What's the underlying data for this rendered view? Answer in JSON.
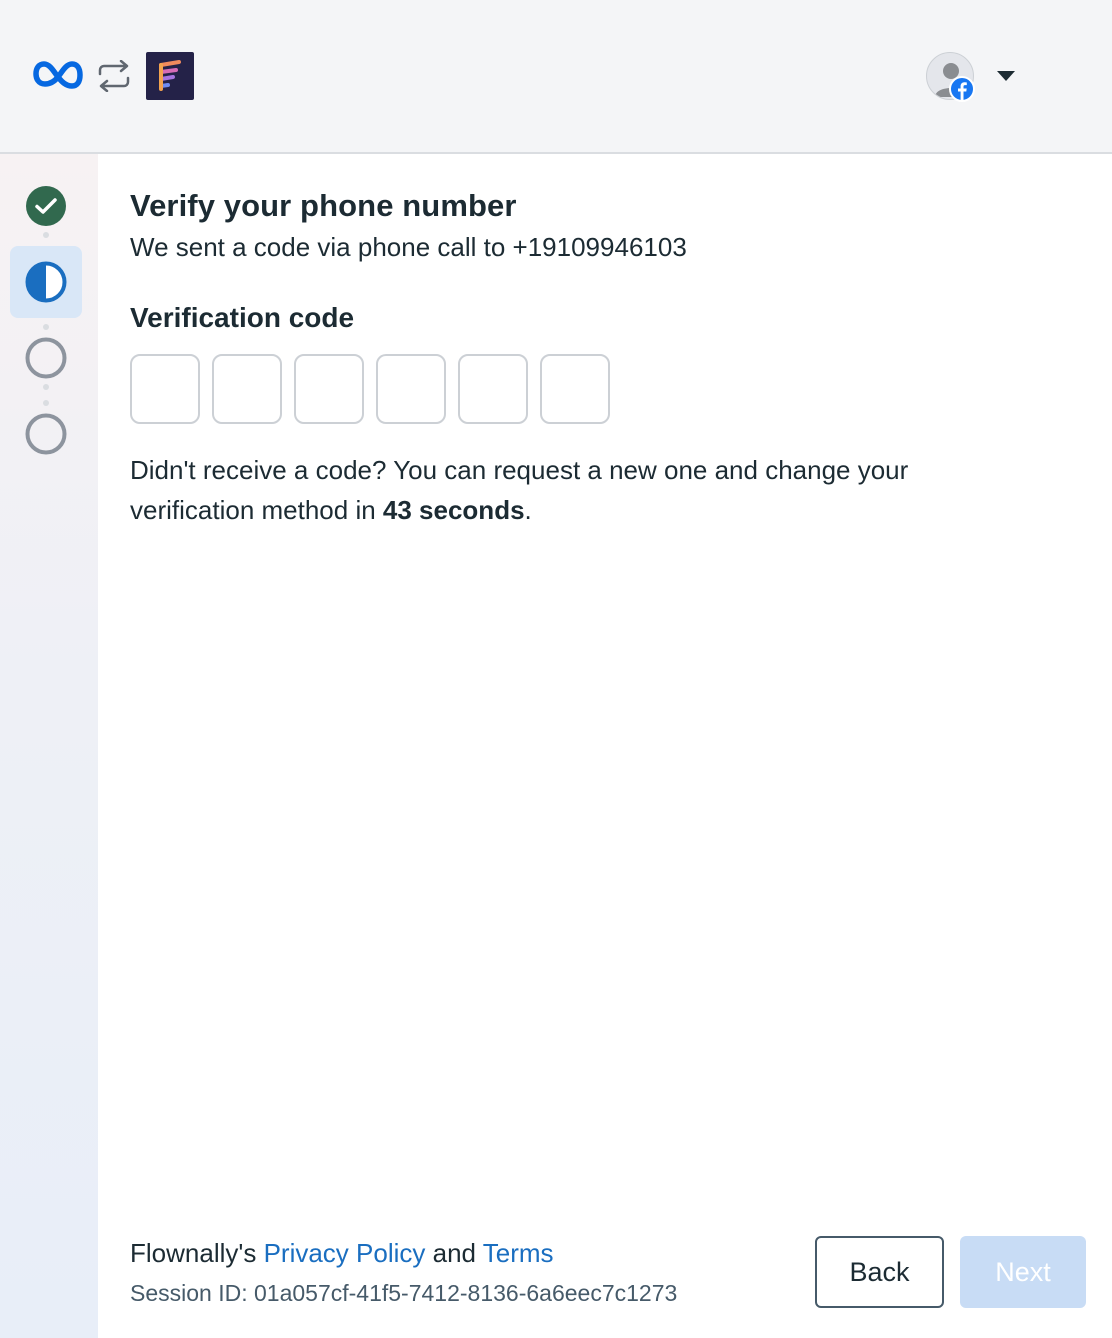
{
  "header": {
    "brand_icon": "meta-logo-icon",
    "connect_icon": "swap-arrows-icon",
    "app_icon": "flownally-logo-icon",
    "account_icon": "facebook-icon",
    "menu_icon": "chevron-down-icon",
    "colors": {
      "meta_blue": "#0668e1",
      "facebook_blue": "#1877f2",
      "app_logo_bg": "#242248"
    }
  },
  "steps": [
    {
      "state": "complete",
      "icon": "check-circle-icon",
      "color": "#31694e"
    },
    {
      "state": "current",
      "icon": "half-circle-icon",
      "color": "#1a6ec0"
    },
    {
      "state": "pending",
      "icon": "empty-circle-icon"
    },
    {
      "state": "pending",
      "icon": "empty-circle-icon"
    }
  ],
  "main": {
    "title": "Verify your phone number",
    "subtitle": "We sent a code via phone call to +19109946103",
    "code_label": "Verification code",
    "code_digits": [
      "",
      "",
      "",
      "",
      "",
      ""
    ],
    "resend_text": "Didn't receive a code? You can request a new one and change your verification method in ",
    "resend_countdown": "43 seconds",
    "resend_suffix": "."
  },
  "footer": {
    "legal_prefix": "Flownally's ",
    "privacy_link": "Privacy Policy",
    "legal_and": " and ",
    "terms_link": "Terms",
    "session_id": "Session ID: 01a057cf-41f5-7412-8136-6a6eec7c1273",
    "back_label": "Back",
    "next_label": "Next",
    "next_enabled": false,
    "link_color": "#1a6ec0"
  }
}
